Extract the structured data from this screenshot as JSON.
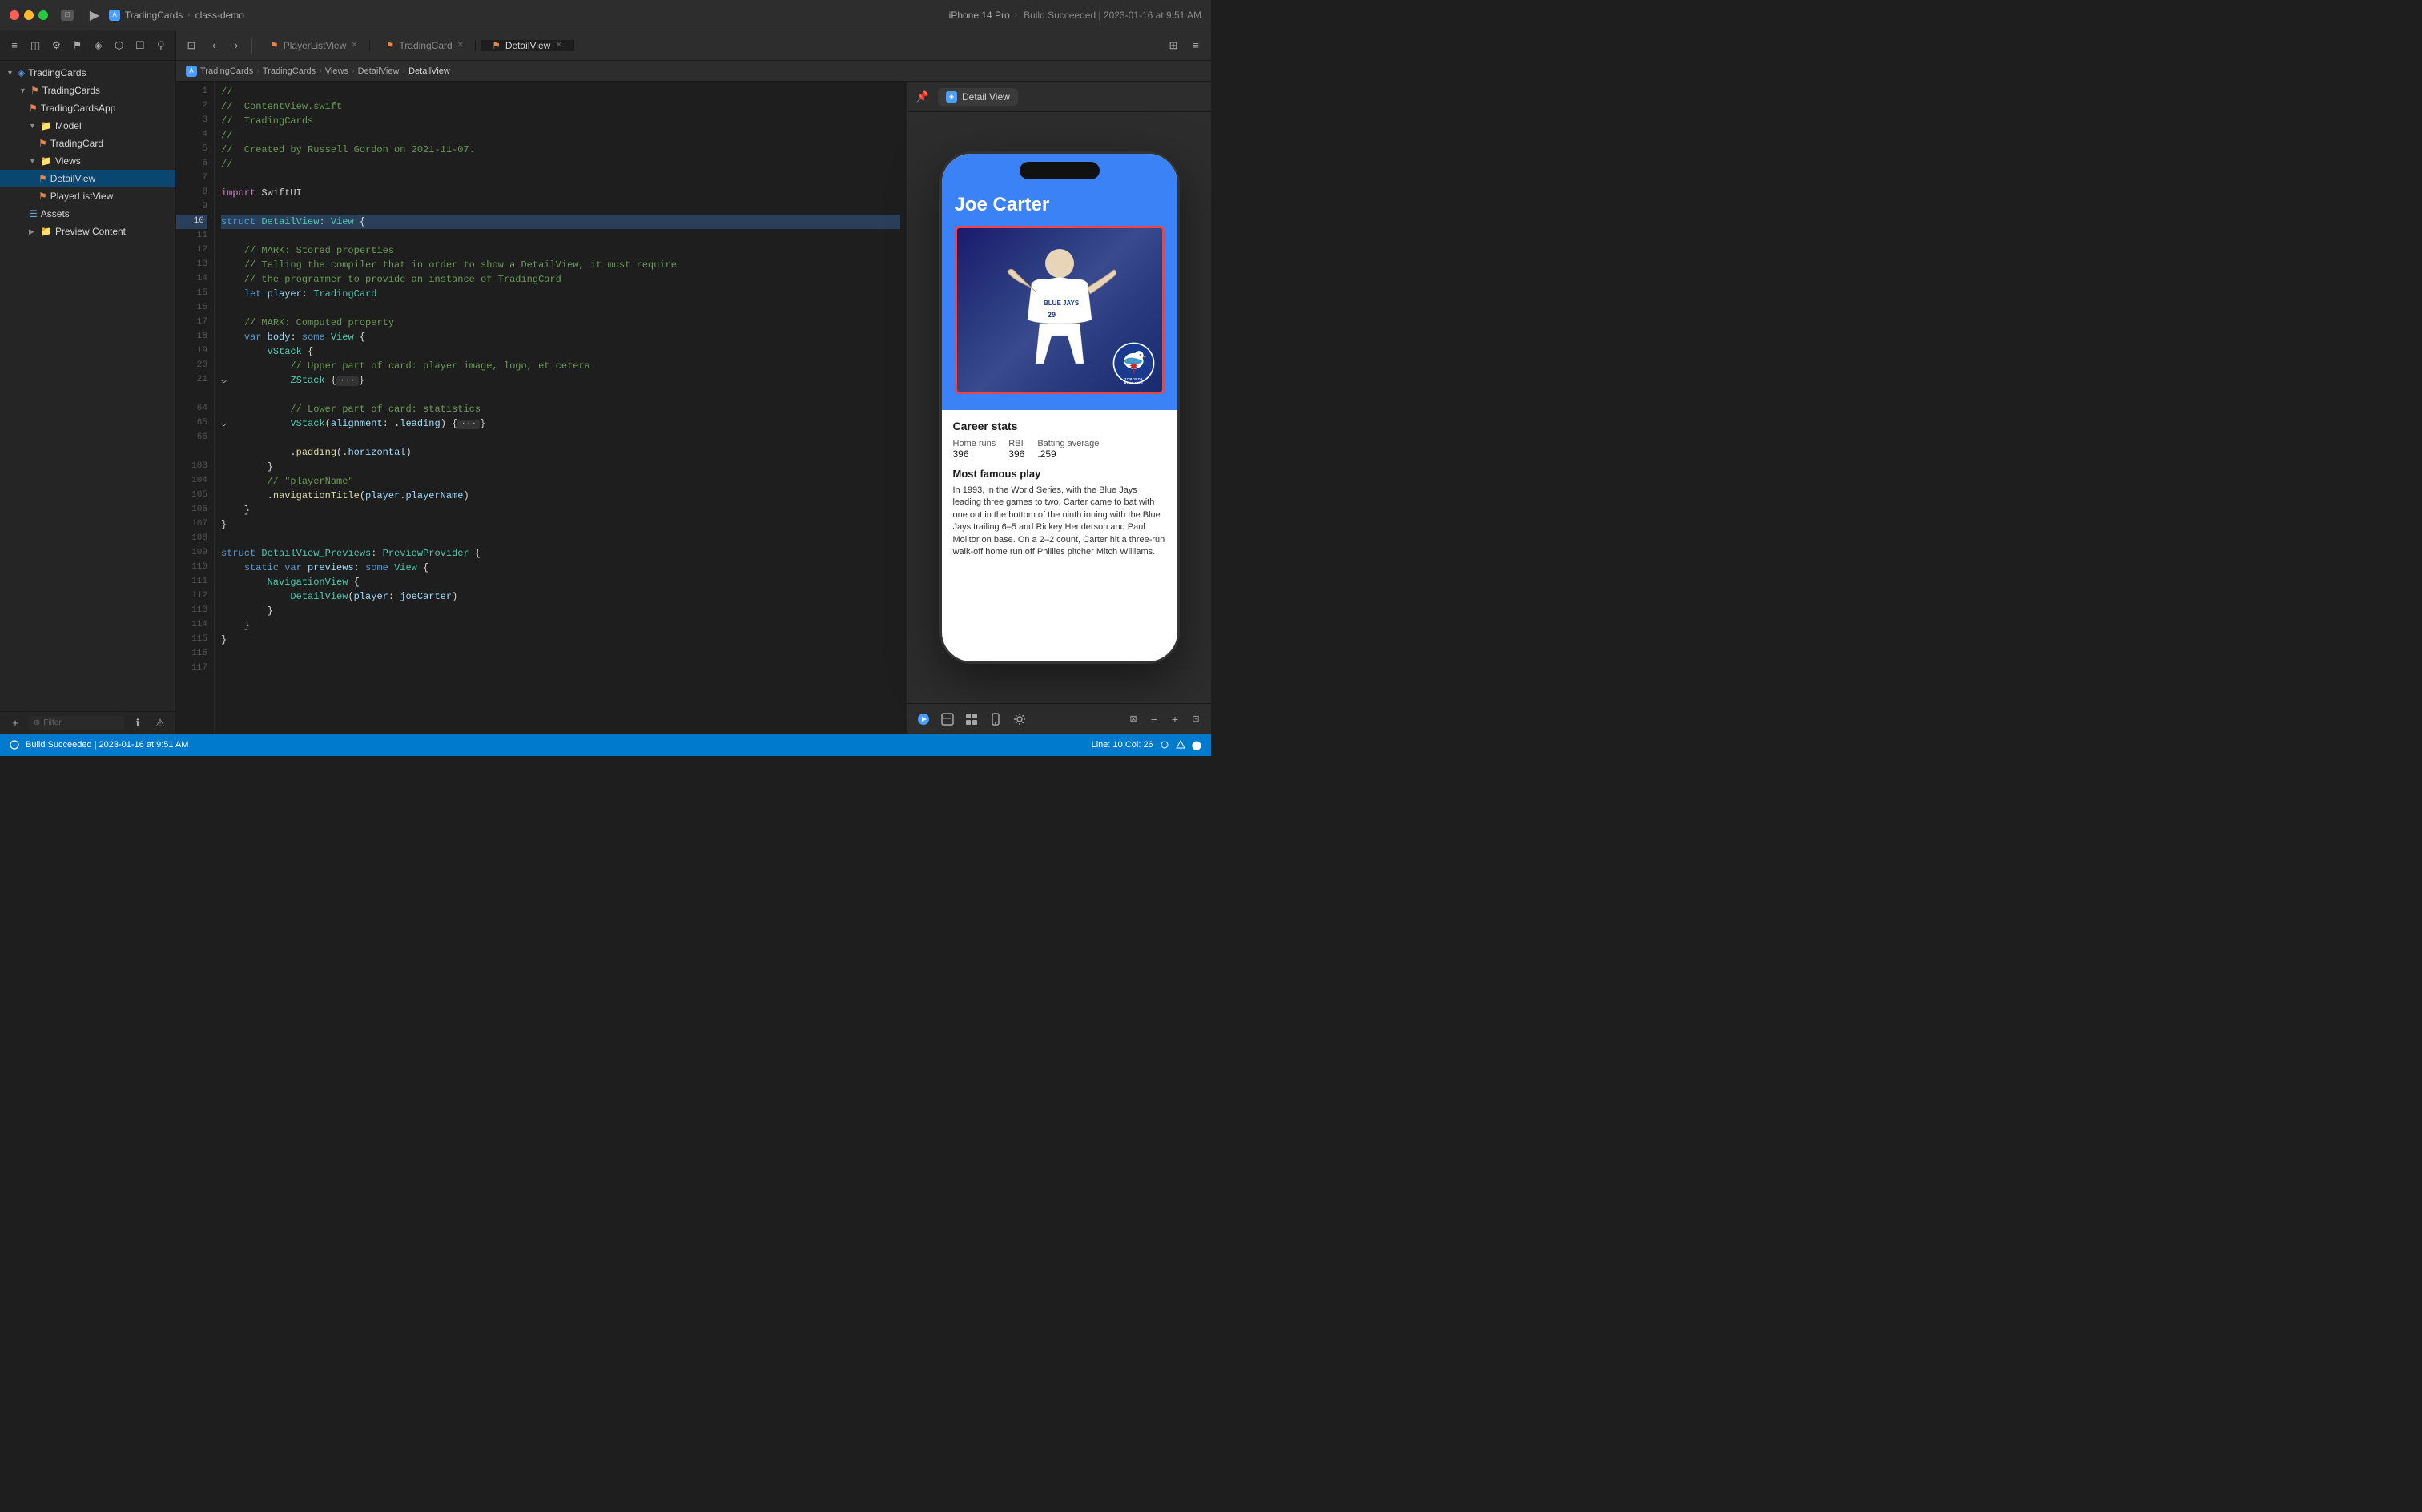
{
  "titleBar": {
    "projectName": "TradingCards",
    "subtitle": "class-demo",
    "buildStatus": "Build Succeeded",
    "buildTime": "2023-01-16 at 9:51 AM",
    "deviceTarget": "iPhone 14 Pro"
  },
  "tabs": [
    {
      "label": "PlayerListView",
      "active": false
    },
    {
      "label": "TradingCard",
      "active": false
    },
    {
      "label": "DetailView",
      "active": true
    }
  ],
  "breadcrumbs": [
    "TradingCards",
    "TradingCards",
    "Views",
    "DetailView",
    "DetailView"
  ],
  "sidebar": {
    "items": [
      {
        "label": "TradingCards",
        "type": "root",
        "indent": 0
      },
      {
        "label": "TradingCards",
        "type": "group",
        "indent": 1
      },
      {
        "label": "TradingCardsApp",
        "type": "swift",
        "indent": 2
      },
      {
        "label": "Model",
        "type": "group",
        "indent": 2
      },
      {
        "label": "TradingCard",
        "type": "swift",
        "indent": 3
      },
      {
        "label": "Views",
        "type": "group",
        "indent": 2
      },
      {
        "label": "DetailView",
        "type": "swift-selected",
        "indent": 3
      },
      {
        "label": "PlayerListView",
        "type": "swift",
        "indent": 3
      },
      {
        "label": "Assets",
        "type": "assets",
        "indent": 2
      },
      {
        "label": "Preview Content",
        "type": "group",
        "indent": 2
      }
    ],
    "filterPlaceholder": "Filter"
  },
  "code": {
    "lines": [
      {
        "num": 1,
        "text": "//",
        "highlight": false
      },
      {
        "num": 2,
        "text": "//  ContentView.swift",
        "highlight": false
      },
      {
        "num": 3,
        "text": "//  TradingCards",
        "highlight": false
      },
      {
        "num": 4,
        "text": "//",
        "highlight": false
      },
      {
        "num": 5,
        "text": "//  Created by Russell Gordon on 2021-11-07.",
        "highlight": false
      },
      {
        "num": 6,
        "text": "//",
        "highlight": false
      },
      {
        "num": 7,
        "text": "",
        "highlight": false
      },
      {
        "num": 8,
        "text": "import SwiftUI",
        "highlight": false
      },
      {
        "num": 9,
        "text": "",
        "highlight": false
      },
      {
        "num": 10,
        "text": "struct DetailView: View {",
        "highlight": true
      },
      {
        "num": 11,
        "text": "",
        "highlight": false
      },
      {
        "num": 12,
        "text": "    // MARK: Stored properties",
        "highlight": false
      },
      {
        "num": 13,
        "text": "    // Telling the compiler that in order to show a DetailView, it must require",
        "highlight": false
      },
      {
        "num": 14,
        "text": "    // the programmer to provide an instance of TradingCard",
        "highlight": false
      },
      {
        "num": 15,
        "text": "    let player: TradingCard",
        "highlight": false
      },
      {
        "num": 16,
        "text": "",
        "highlight": false
      },
      {
        "num": 17,
        "text": "    // MARK: Computed property",
        "highlight": false
      },
      {
        "num": 18,
        "text": "    var body: some View {",
        "highlight": false
      },
      {
        "num": 19,
        "text": "        VStack {",
        "highlight": false
      },
      {
        "num": 20,
        "text": "            // Upper part of card: player image, logo, et cetera.",
        "highlight": false
      },
      {
        "num": 21,
        "text": "⌵           ZStack { ··· }",
        "highlight": false
      },
      {
        "num": 64,
        "text": "",
        "highlight": false
      },
      {
        "num": 65,
        "text": "            // Lower part of card: statistics",
        "highlight": false
      },
      {
        "num": 66,
        "text": "⌵           VStack(alignment: .leading) { ··· }",
        "highlight": false
      },
      {
        "num": 103,
        "text": "            .padding(.horizontal)",
        "highlight": false
      },
      {
        "num": 104,
        "text": "        }",
        "highlight": false
      },
      {
        "num": 105,
        "text": "        // \"playerName\"",
        "highlight": false
      },
      {
        "num": 106,
        "text": "        .navigationTitle(player.playerName)",
        "highlight": false
      },
      {
        "num": 107,
        "text": "    }",
        "highlight": false
      },
      {
        "num": 108,
        "text": "}",
        "highlight": false
      },
      {
        "num": 109,
        "text": "",
        "highlight": false
      },
      {
        "num": 110,
        "text": "struct DetailView_Previews: PreviewProvider {",
        "highlight": false
      },
      {
        "num": 111,
        "text": "    static var previews: some View {",
        "highlight": false
      },
      {
        "num": 112,
        "text": "        NavigationView {",
        "highlight": false
      },
      {
        "num": 113,
        "text": "            DetailView(player: joeCarter)",
        "highlight": false
      },
      {
        "num": 114,
        "text": "        }",
        "highlight": false
      },
      {
        "num": 115,
        "text": "    }",
        "highlight": false
      },
      {
        "num": 116,
        "text": "}",
        "highlight": false
      },
      {
        "num": 117,
        "text": "",
        "highlight": false
      }
    ]
  },
  "preview": {
    "label": "Detail View",
    "pinned": true,
    "player": {
      "name": "Joe Carter",
      "stats": {
        "title": "Career stats",
        "homeRunsLabel": "Home runs",
        "homeRunsValue": "396",
        "rbiLabel": "RBI",
        "rbiValue": "396",
        "battingAvgLabel": "Batting average",
        "battingAvgValue": ".259"
      },
      "mostFamousTitle": "Most famous play",
      "mostFamousText": "In 1993, in the World Series, with the Blue Jays leading three games to two, Carter came to bat with one out in the bottom of the ninth inning with the Blue Jays trailing 6–5 and Rickey Henderson and Paul Molitor on base. On a 2–2 count, Carter hit a three-run walk-off home run off Phillies pitcher Mitch Williams."
    }
  },
  "statusBar": {
    "buildInfo": "Build Succeeded  |  2023-01-16 at 9:51 AM",
    "lineCol": "Line: 10  Col: 26",
    "filterLabel": "Filter"
  }
}
